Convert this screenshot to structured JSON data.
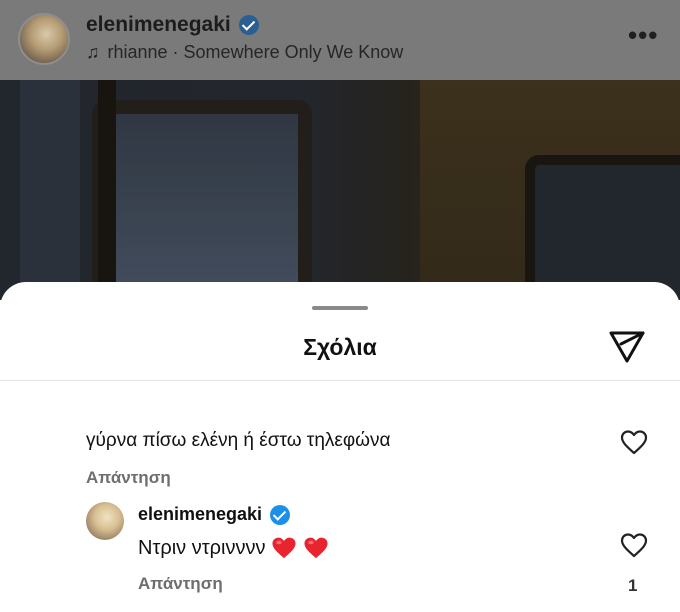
{
  "post": {
    "username": "elenimenegaki",
    "music": "rhianne · Somewhere Only We Know"
  },
  "sheet": {
    "title": "Σχόλια"
  },
  "comments": [
    {
      "text": "γύρνα πίσω ελένη ή έστω τηλεφώνα",
      "reply_label": "Απάντηση"
    }
  ],
  "replies": [
    {
      "username": "elenimenegaki",
      "text": "Ντριν ντρινννν",
      "emojis": [
        "red-heart",
        "red-heart"
      ],
      "reply_label": "Απάντηση",
      "likes": "1"
    }
  ],
  "colors": {
    "verified_badge": "#1d8fe6",
    "emoji_heart": "#e8242f"
  },
  "icons": {
    "music": "music-note-icon",
    "more": "more-options-icon",
    "share": "paper-plane-icon",
    "like": "heart-outline-icon"
  }
}
